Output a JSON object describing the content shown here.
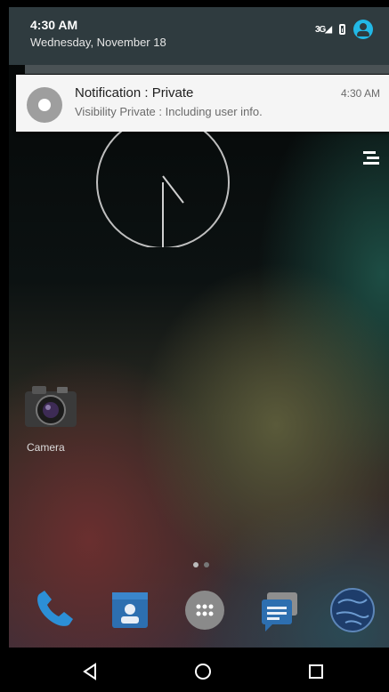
{
  "status_bar": {
    "time": "4:30 AM",
    "date": "Wednesday, November 18",
    "signal_label": "3G",
    "icons": [
      "signal-icon",
      "battery-icon",
      "user-icon"
    ]
  },
  "notification": {
    "title": "Notification : Private",
    "text": "Visibility Private : Including user info.",
    "time": "4:30 AM",
    "icon": "app-icon"
  },
  "home": {
    "camera_label": "Camera",
    "dock": [
      "phone-icon",
      "contacts-icon",
      "app-drawer-icon",
      "messaging-icon",
      "browser-icon"
    ]
  },
  "navigation": [
    "back-icon",
    "home-icon",
    "recents-icon"
  ],
  "colors": {
    "shade_bg": "#2f3b3f",
    "accent": "#22b8e6",
    "card_bg": "#f5f5f5"
  }
}
